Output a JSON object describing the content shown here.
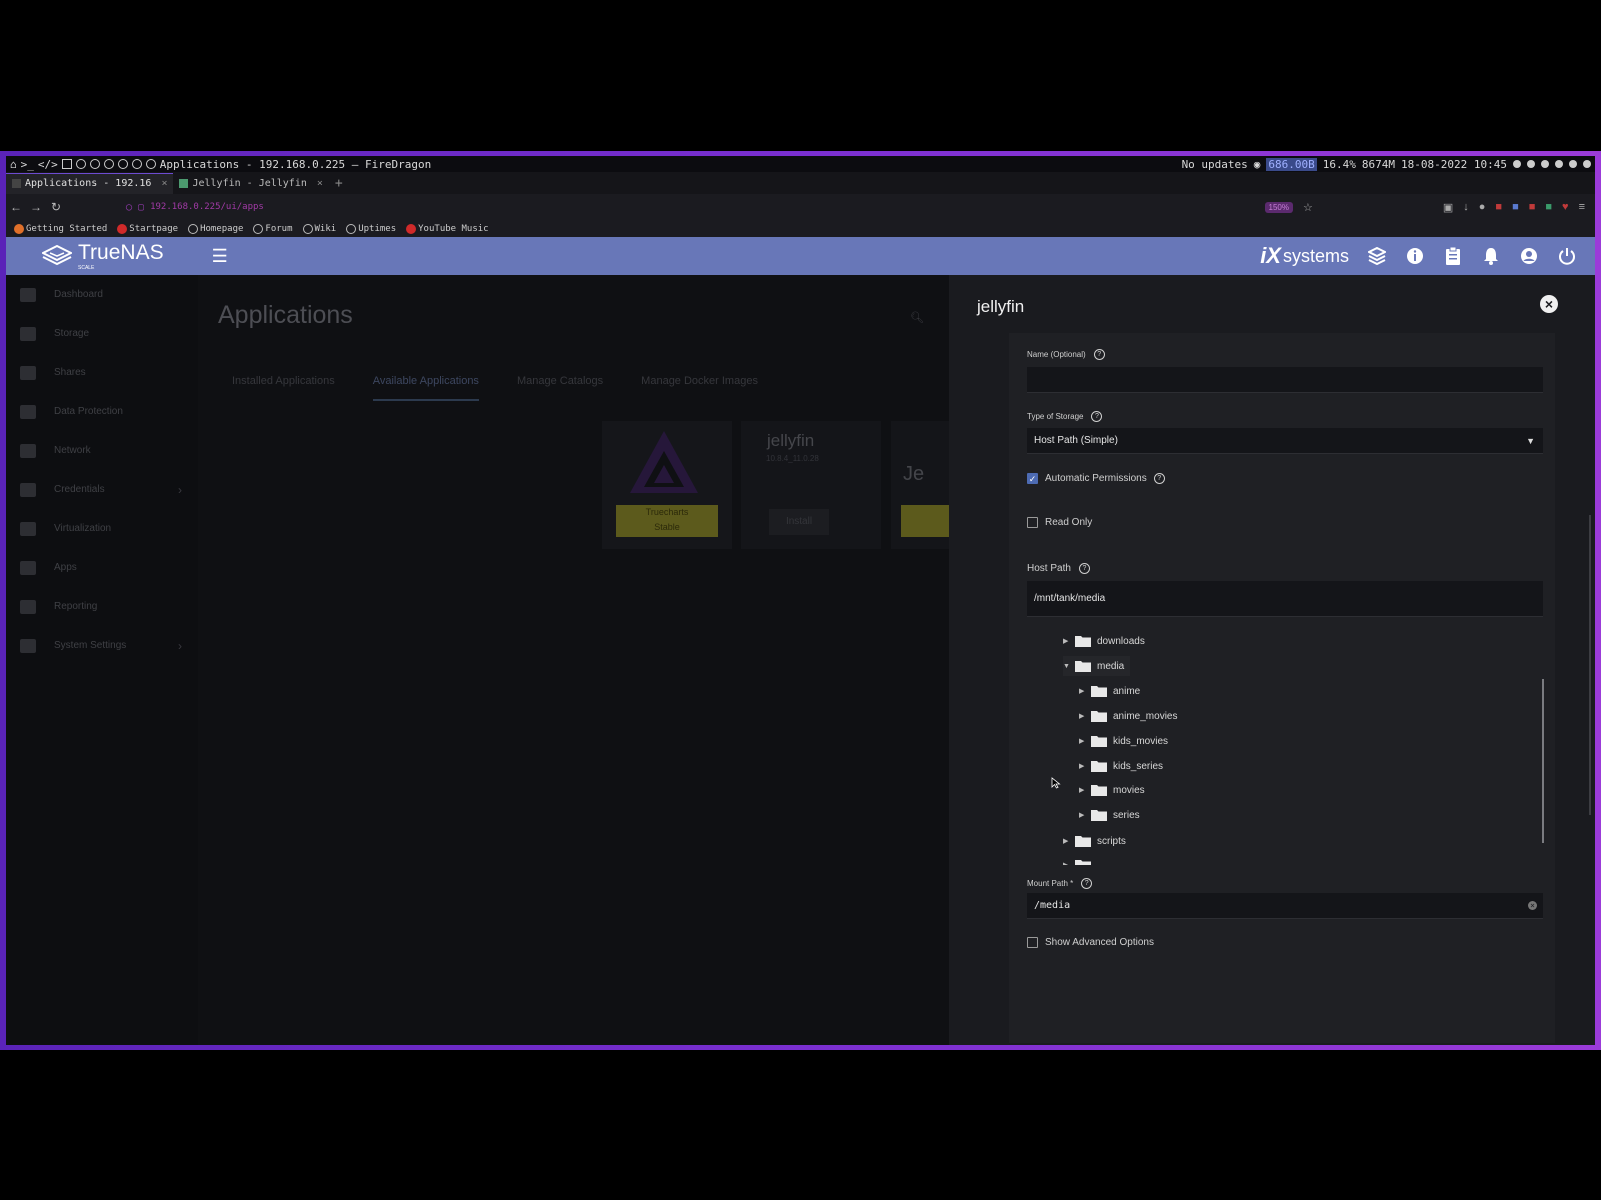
{
  "os": {
    "window_title": "Applications - 192.168.0.225 — FireDragon",
    "status": {
      "updates": "No updates",
      "net": "686.00B",
      "cpu": "16.4%",
      "mem": "8674M",
      "datetime": "18-08-2022 10:45"
    }
  },
  "browser": {
    "tabs": [
      {
        "label": "Applications - 192.16",
        "active": true
      },
      {
        "label": "Jellyfin - Jellyfin",
        "active": false
      }
    ],
    "url": "192.168.0.225/ui/apps",
    "zoom": "150%",
    "bookmarks": [
      "Getting Started",
      "Startpage",
      "Homepage",
      "Forum",
      "Wiki",
      "Uptimes",
      "YouTube Music"
    ]
  },
  "header": {
    "logo_text": "TrueNAS",
    "logo_sub": "SCALE",
    "vendor": "systems",
    "vendor_mark": "iX"
  },
  "sidebar": {
    "items": [
      {
        "label": "Dashboard",
        "icon": "dashboard-icon",
        "chevron": false
      },
      {
        "label": "Storage",
        "icon": "storage-icon",
        "chevron": false
      },
      {
        "label": "Shares",
        "icon": "shares-icon",
        "chevron": false
      },
      {
        "label": "Data Protection",
        "icon": "shield-icon",
        "chevron": false
      },
      {
        "label": "Network",
        "icon": "network-icon",
        "chevron": false
      },
      {
        "label": "Credentials",
        "icon": "key-icon",
        "chevron": true
      },
      {
        "label": "Virtualization",
        "icon": "laptop-icon",
        "chevron": false
      },
      {
        "label": "Apps",
        "icon": "apps-icon",
        "chevron": false
      },
      {
        "label": "Reporting",
        "icon": "chart-icon",
        "chevron": false
      },
      {
        "label": "System Settings",
        "icon": "gear-icon",
        "chevron": true
      }
    ]
  },
  "main": {
    "title": "Applications",
    "tabs": [
      "Installed Applications",
      "Available Applications",
      "Manage Catalogs",
      "Manage Docker Images"
    ],
    "active_tab": 1,
    "cards": {
      "card1_label1": "Truecharts",
      "card1_label2": "Stable",
      "card2_title": "jellyfin",
      "card2_version": "10.8.4_11.0.28",
      "card2_button": "Install",
      "card3_title": "Je"
    }
  },
  "panel": {
    "title": "jellyfin",
    "name_label": "Name (Optional)",
    "name_value": "",
    "storage_type_label": "Type of Storage",
    "storage_type_value": "Host Path (Simple)",
    "auto_perm_label": "Automatic Permissions",
    "auto_perm_checked": true,
    "read_only_label": "Read Only",
    "read_only_checked": false,
    "host_path_label": "Host Path",
    "host_path_value": "/mnt/tank/media",
    "tree": [
      {
        "label": "downloads",
        "depth": 1,
        "expanded": false
      },
      {
        "label": "media",
        "depth": 1,
        "expanded": true,
        "selected": true
      },
      {
        "label": "anime",
        "depth": 2,
        "expanded": false
      },
      {
        "label": "anime_movies",
        "depth": 2,
        "expanded": false
      },
      {
        "label": "kids_movies",
        "depth": 2,
        "expanded": false
      },
      {
        "label": "kids_series",
        "depth": 2,
        "expanded": false
      },
      {
        "label": "movies",
        "depth": 2,
        "expanded": false
      },
      {
        "label": "series",
        "depth": 2,
        "expanded": false
      },
      {
        "label": "scripts",
        "depth": 1,
        "expanded": false
      }
    ],
    "mount_path_label": "Mount Path *",
    "mount_path_value": "/media",
    "advanced_label": "Show Advanced Options",
    "advanced_checked": false
  },
  "colors": {
    "header": "#6877b8",
    "accent": "#4d6bb3",
    "frame": "#7a2fd0",
    "label_yellow": "#5c5a1c"
  }
}
